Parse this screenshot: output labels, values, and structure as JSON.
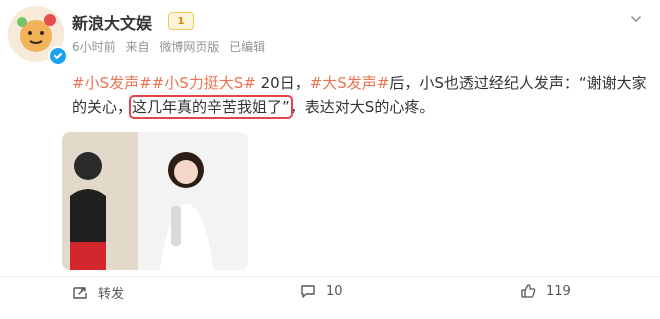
{
  "post": {
    "username": "新浪大文娱",
    "badge": "1",
    "meta": {
      "time": "6小时前",
      "source_prefix": "来自",
      "source": "微博网页版",
      "edited": "已编辑"
    },
    "text_parts": [
      {
        "t": "#小S发声#",
        "topic": true
      },
      {
        "t": "#小S力挺大S#",
        "topic": true
      },
      {
        "t": " 20日，",
        "topic": false
      },
      {
        "t": "#大S发声#",
        "topic": true
      },
      {
        "t": "后，小S也透过经纪人发声：“谢谢大家的关心，",
        "topic": false
      },
      {
        "t": "这几年真的辛苦我姐了”",
        "topic": false,
        "highlight": true
      },
      {
        "t": "，表达对大S的心疼。",
        "topic": false
      }
    ],
    "image": {
      "alt": ""
    }
  },
  "actions": {
    "share_label": "转发",
    "comment_count": "10",
    "like_count": "119"
  },
  "icons": {
    "chevron": "chevron-down-icon",
    "verified": "verified-check-icon",
    "share": "share-icon",
    "comment": "comment-icon",
    "like": "like-icon"
  },
  "colors": {
    "topic": "#eb7350",
    "highlight_border": "#e3454a",
    "meta": "#939393",
    "verified": "#1da1f2"
  }
}
